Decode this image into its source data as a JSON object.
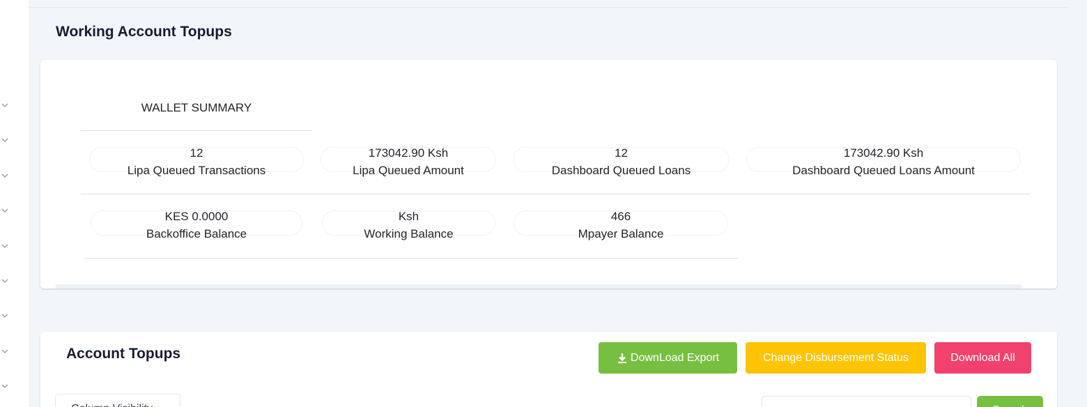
{
  "sidebar": {
    "chevrons": [
      "chevron-down-icon",
      "chevron-down-icon",
      "chevron-down-icon",
      "chevron-down-icon",
      "chevron-down-icon",
      "chevron-down-icon",
      "chevron-down-icon",
      "chevron-down-icon",
      "chevron-down-icon"
    ]
  },
  "page": {
    "title": "Working Account Topups"
  },
  "wallet": {
    "title": "WALLET SUMMARY",
    "stats": [
      {
        "value": "12",
        "label": "Lipa Queued Transactions"
      },
      {
        "value": "173042.90 Ksh",
        "label": "Lipa Queued Amount"
      },
      {
        "value": "12",
        "label": "Dashboard Queued Loans"
      },
      {
        "value": "173042.90 Ksh",
        "label": "Dashboard Queued Loans Amount"
      },
      {
        "value": "KES 0.0000",
        "label": "Backoffice Balance"
      },
      {
        "value": "Ksh",
        "label": "Working Balance"
      },
      {
        "value": "466",
        "label": "Mpayer Balance"
      }
    ]
  },
  "topups": {
    "title": "Account Topups",
    "download_export_label": "DownLoad Export",
    "change_status_label": "Change Disbursement Status",
    "download_all_label": "Download All",
    "column_visibility_label": "Column Visibility",
    "search_button_label": "Search"
  },
  "colors": {
    "green": "#77bf41",
    "yellow": "#ffc400",
    "pink": "#f1416c"
  }
}
